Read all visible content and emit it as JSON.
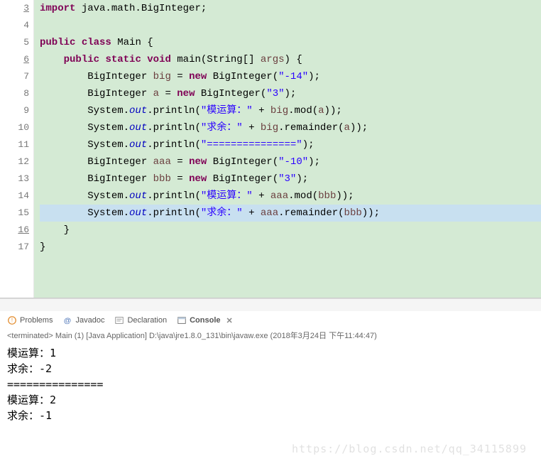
{
  "editor": {
    "highlighted_line": 15,
    "lines": [
      {
        "num": 3,
        "underline": true,
        "tokens": [
          [
            "kw",
            "import"
          ],
          [
            "",
            " java.math.BigInteger;"
          ]
        ]
      },
      {
        "num": 4,
        "tokens": []
      },
      {
        "num": 5,
        "tokens": [
          [
            "kw",
            "public"
          ],
          [
            "",
            " "
          ],
          [
            "kw",
            "class"
          ],
          [
            "",
            " Main {"
          ]
        ]
      },
      {
        "num": 6,
        "indent": 4,
        "underline": true,
        "tokens": [
          [
            "kw",
            "public"
          ],
          [
            "",
            " "
          ],
          [
            "kw",
            "static"
          ],
          [
            "",
            " "
          ],
          [
            "kw",
            "void"
          ],
          [
            "",
            " main(String[] "
          ],
          [
            "par",
            "args"
          ],
          [
            "",
            ") {"
          ]
        ]
      },
      {
        "num": 7,
        "indent": 8,
        "tokens": [
          [
            "",
            "BigInteger "
          ],
          [
            "var",
            "big"
          ],
          [
            "",
            " = "
          ],
          [
            "kw",
            "new"
          ],
          [
            "",
            " BigInteger("
          ],
          [
            "str",
            "\"-14\""
          ],
          [
            "",
            ");"
          ]
        ]
      },
      {
        "num": 8,
        "indent": 8,
        "tokens": [
          [
            "",
            "BigInteger "
          ],
          [
            "var",
            "a"
          ],
          [
            "",
            " = "
          ],
          [
            "kw",
            "new"
          ],
          [
            "",
            " BigInteger("
          ],
          [
            "str",
            "\"3\""
          ],
          [
            "",
            ");"
          ]
        ]
      },
      {
        "num": 9,
        "indent": 8,
        "tokens": [
          [
            "",
            "System."
          ],
          [
            "fld",
            "out"
          ],
          [
            "",
            ".println("
          ],
          [
            "str",
            "\"模运算：\""
          ],
          [
            "",
            " + "
          ],
          [
            "var",
            "big"
          ],
          [
            "",
            ".mod("
          ],
          [
            "var",
            "a"
          ],
          [
            "",
            "));"
          ]
        ]
      },
      {
        "num": 10,
        "indent": 8,
        "tokens": [
          [
            "",
            "System."
          ],
          [
            "fld",
            "out"
          ],
          [
            "",
            ".println("
          ],
          [
            "str",
            "\"求余：\""
          ],
          [
            "",
            " + "
          ],
          [
            "var",
            "big"
          ],
          [
            "",
            ".remainder("
          ],
          [
            "var",
            "a"
          ],
          [
            "",
            "));"
          ]
        ]
      },
      {
        "num": 11,
        "indent": 8,
        "tokens": [
          [
            "",
            "System."
          ],
          [
            "fld",
            "out"
          ],
          [
            "",
            ".println("
          ],
          [
            "str",
            "\"===============\""
          ],
          [
            "",
            ");"
          ]
        ]
      },
      {
        "num": 12,
        "indent": 8,
        "tokens": [
          [
            "",
            "BigInteger "
          ],
          [
            "var",
            "aaa"
          ],
          [
            "",
            " = "
          ],
          [
            "kw",
            "new"
          ],
          [
            "",
            " BigInteger("
          ],
          [
            "str",
            "\"-10\""
          ],
          [
            "",
            ");"
          ]
        ]
      },
      {
        "num": 13,
        "indent": 8,
        "tokens": [
          [
            "",
            "BigInteger "
          ],
          [
            "var",
            "bbb"
          ],
          [
            "",
            " = "
          ],
          [
            "kw",
            "new"
          ],
          [
            "",
            " BigInteger("
          ],
          [
            "str",
            "\"3\""
          ],
          [
            "",
            ");"
          ]
        ]
      },
      {
        "num": 14,
        "indent": 8,
        "tokens": [
          [
            "",
            "System."
          ],
          [
            "fld",
            "out"
          ],
          [
            "",
            ".println("
          ],
          [
            "str",
            "\"模运算：\""
          ],
          [
            "",
            " + "
          ],
          [
            "var",
            "aaa"
          ],
          [
            "",
            ".mod("
          ],
          [
            "var",
            "bbb"
          ],
          [
            "",
            "));"
          ]
        ]
      },
      {
        "num": 15,
        "indent": 8,
        "tokens": [
          [
            "",
            "System."
          ],
          [
            "fld",
            "out"
          ],
          [
            "",
            ".println("
          ],
          [
            "str",
            "\"求余：\""
          ],
          [
            "",
            " + "
          ],
          [
            "var",
            "aaa"
          ],
          [
            "",
            ".remainder("
          ],
          [
            "var",
            "bbb"
          ],
          [
            "",
            "));"
          ]
        ]
      },
      {
        "num": 16,
        "indent": 4,
        "underline": true,
        "tokens": [
          [
            "",
            "}"
          ]
        ]
      },
      {
        "num": 17,
        "indent": 0,
        "tokens": [
          [
            "",
            "}"
          ]
        ]
      }
    ]
  },
  "tabs": {
    "problems": "Problems",
    "javadoc": "Javadoc",
    "declaration": "Declaration",
    "console": "Console"
  },
  "consoleHead": "<terminated> Main (1) [Java Application] D:\\java\\jre1.8.0_131\\bin\\javaw.exe (2018年3月24日 下午11:44:47)",
  "consoleOut": "模运算：1\n求余：-2\n===============\n模运算：2\n求余：-1",
  "watermark": "https://blog.csdn.net/qq_34115899"
}
